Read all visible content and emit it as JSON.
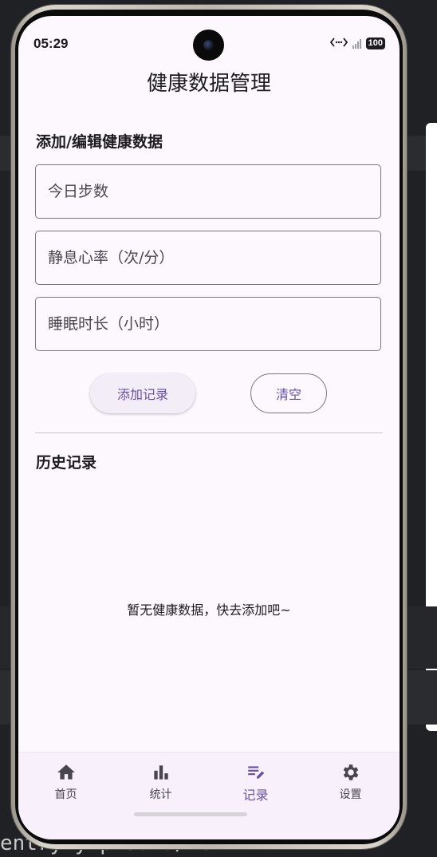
{
  "status_bar": {
    "time": "05:29",
    "battery": "100",
    "network_icon": "data-transfer-icon"
  },
  "app": {
    "title": "健康数据管理"
  },
  "form": {
    "section_title": "添加/编辑健康数据",
    "steps_placeholder": "今日步数",
    "heart_rate_placeholder": "静息心率（次/分）",
    "sleep_placeholder": "睡眠时长（小时）",
    "add_label": "添加记录",
    "clear_label": "清空"
  },
  "history": {
    "section_title": "历史记录",
    "empty_text": "暂无健康数据，快去添加吧~"
  },
  "nav": {
    "items": [
      {
        "label": "首页",
        "icon": "home-icon"
      },
      {
        "label": "统计",
        "icon": "bar-chart-icon"
      },
      {
        "label": "记录",
        "icon": "edit-note-icon"
      },
      {
        "label": "设置",
        "icon": "gear-icon"
      }
    ],
    "active_index": 2
  },
  "background": {
    "terminal_text": "entry                              y       p   data/lo"
  },
  "colors": {
    "accent": "#6750a4",
    "surface": "#fdf7fe",
    "outline": "#79747e"
  }
}
